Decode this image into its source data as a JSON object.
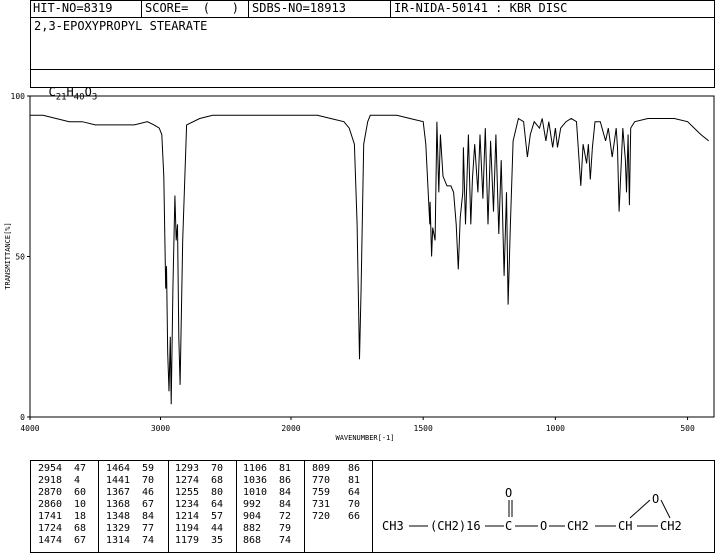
{
  "header": {
    "hit_no": "HIT-NO=8319",
    "score": "SCORE=  (   )",
    "sdbs_no": "SDBS-NO=18913",
    "ir_info": "IR-NIDA-50141 : KBR DISC"
  },
  "compound_name": "2,3-EPOXYPROPYL STEARATE",
  "formula": {
    "main": "C",
    "sub1": "21",
    "h": "H",
    "sub2": "40",
    "o": "O",
    "sub3": "3"
  },
  "chart_data": {
    "type": "line",
    "xlabel": "WAVENUMBER[-1]",
    "ylabel": "TRANSMITTANCE[%]",
    "xlim": [
      4000,
      400
    ],
    "ylim": [
      0,
      100
    ],
    "x_ticks": [
      4000,
      3000,
      2000,
      1500,
      1000,
      500
    ],
    "x_tick_labels": [
      "4000",
      "3000",
      "2000",
      "1500",
      "1000",
      "500"
    ],
    "y_ticks": [
      0,
      50,
      100
    ],
    "y_tick_labels": [
      "0",
      "50",
      "100"
    ],
    "grid": false,
    "line_color": "#000000",
    "x": [
      4000,
      3900,
      3800,
      3700,
      3600,
      3500,
      3400,
      3300,
      3200,
      3100,
      3050,
      3010,
      2990,
      2975,
      2960,
      2954,
      2945,
      2935,
      2925,
      2918,
      2905,
      2890,
      2880,
      2870,
      2860,
      2850,
      2830,
      2800,
      2700,
      2600,
      2500,
      2400,
      2300,
      2200,
      2100,
      2000,
      1950,
      1900,
      1850,
      1800,
      1780,
      1760,
      1750,
      1741,
      1735,
      1725,
      1710,
      1700,
      1680,
      1650,
      1600,
      1550,
      1500,
      1490,
      1475,
      1474,
      1468,
      1464,
      1455,
      1448,
      1441,
      1435,
      1425,
      1410,
      1395,
      1385,
      1375,
      1367,
      1360,
      1350,
      1348,
      1340,
      1329,
      1320,
      1314,
      1305,
      1293,
      1285,
      1274,
      1265,
      1255,
      1245,
      1234,
      1225,
      1214,
      1205,
      1194,
      1185,
      1179,
      1170,
      1160,
      1140,
      1120,
      1106,
      1095,
      1080,
      1060,
      1050,
      1036,
      1025,
      1010,
      1000,
      992,
      980,
      960,
      940,
      920,
      904,
      895,
      882,
      875,
      868,
      860,
      850,
      830,
      810,
      800,
      785,
      770,
      765,
      759,
      745,
      735,
      731,
      725,
      720,
      715,
      700,
      650,
      600,
      550,
      500,
      450,
      420,
      400
    ],
    "y": [
      94,
      94,
      93,
      92,
      92,
      91,
      91,
      91,
      91,
      92,
      91,
      90,
      88,
      75,
      40,
      47,
      20,
      8,
      25,
      4,
      40,
      69,
      55,
      60,
      25,
      10,
      55,
      91,
      93,
      94,
      94,
      94,
      94,
      94,
      94,
      94,
      94,
      94,
      93,
      92,
      90,
      85,
      60,
      18,
      40,
      85,
      92,
      94,
      94,
      94,
      94,
      93,
      92,
      85,
      60,
      67,
      50,
      59,
      55,
      92,
      70,
      88,
      75,
      72,
      72,
      70,
      60,
      46,
      62,
      70,
      84,
      60,
      88,
      60,
      74,
      85,
      70,
      88,
      68,
      90,
      60,
      86,
      64,
      88,
      57,
      80,
      44,
      70,
      35,
      60,
      86,
      93,
      92,
      81,
      88,
      92,
      90,
      93,
      86,
      92,
      84,
      90,
      84,
      90,
      92,
      93,
      92,
      72,
      85,
      79,
      85,
      74,
      84,
      92,
      92,
      86,
      90,
      81,
      90,
      84,
      64,
      90,
      80,
      70,
      88,
      66,
      90,
      92,
      93,
      93,
      93,
      92,
      88,
      86
    ]
  },
  "peak_table": {
    "col1": [
      [
        "2954",
        "47"
      ],
      [
        "2918",
        "4"
      ],
      [
        "2870",
        "60"
      ],
      [
        "2860",
        "10"
      ],
      [
        "1741",
        "18"
      ],
      [
        "1724",
        "68"
      ],
      [
        "1474",
        "67"
      ]
    ],
    "col2": [
      [
        "1464",
        "59"
      ],
      [
        "1441",
        "70"
      ],
      [
        "1367",
        "46"
      ],
      [
        "1368",
        "67"
      ],
      [
        "1348",
        "84"
      ],
      [
        "1329",
        "77"
      ],
      [
        "1314",
        "74"
      ]
    ],
    "col3": [
      [
        "1293",
        "70"
      ],
      [
        "1274",
        "68"
      ],
      [
        "1255",
        "80"
      ],
      [
        "1234",
        "64"
      ],
      [
        "1214",
        "57"
      ],
      [
        "1194",
        "44"
      ],
      [
        "1179",
        "35"
      ]
    ],
    "col4": [
      [
        "1106",
        "81"
      ],
      [
        "1036",
        "86"
      ],
      [
        "1010",
        "84"
      ],
      [
        "992",
        "84"
      ],
      [
        "904",
        "72"
      ],
      [
        "882",
        "79"
      ],
      [
        "868",
        "74"
      ]
    ],
    "col5": [
      [
        "809",
        "86"
      ],
      [
        "770",
        "81"
      ],
      [
        "759",
        "64"
      ],
      [
        "731",
        "70"
      ],
      [
        "720",
        "66"
      ]
    ]
  },
  "structure": {
    "label_ch3": "CH3",
    "label_chain": "(CH2)16",
    "label_c": "C",
    "label_o_top": "O",
    "label_o_ester": "O",
    "label_ch2a": "CH2",
    "label_ch": "CH",
    "label_ch2b": "CH2",
    "label_o_epox": "O"
  }
}
